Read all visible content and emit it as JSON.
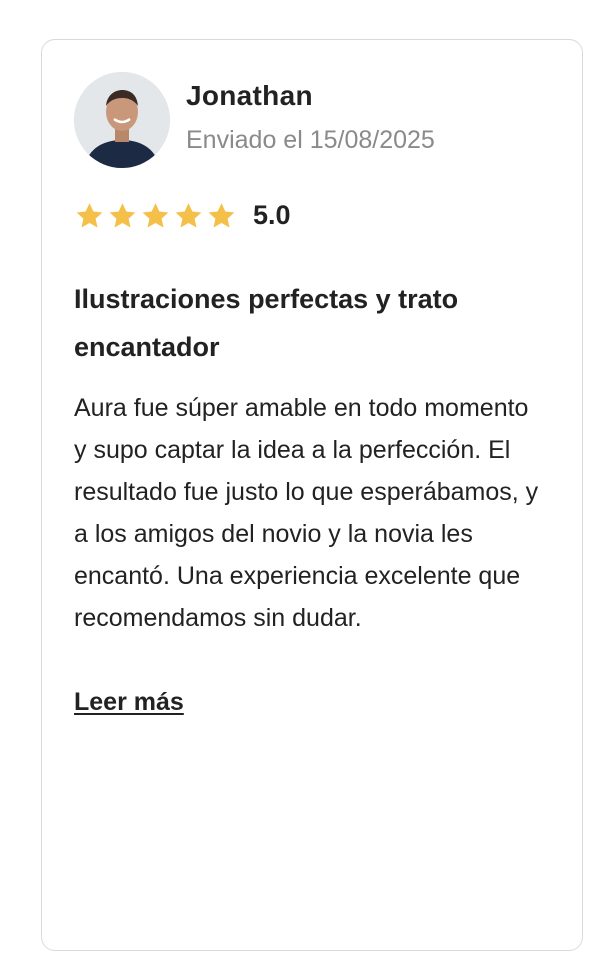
{
  "review": {
    "author": "Jonathan",
    "submitted": "Enviado el 15/08/2025",
    "avatar_icon": "user-photo",
    "rating": 5,
    "rating_max": 5,
    "rating_label": "5.0",
    "star_color": "#F5C04A",
    "title": "Ilustraciones perfectas y trato encantador",
    "body": "Aura fue súper amable en todo momento y supo captar la idea a la perfección. El resultado fue justo lo que esperábamos, y a los amigos del novio y la novia les encantó. Una experiencia excelente que recomendamos sin dudar.",
    "read_more": "Leer más"
  }
}
